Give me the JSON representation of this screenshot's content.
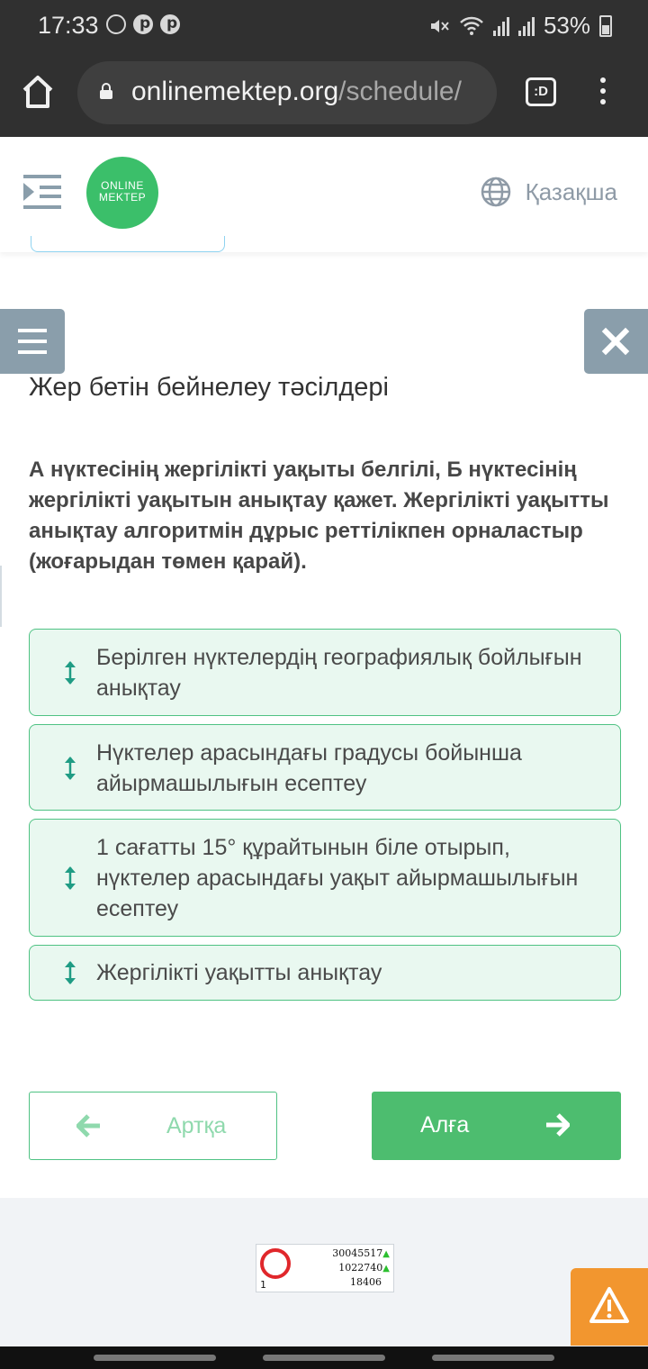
{
  "status_bar": {
    "time": "17:33",
    "battery": "53%"
  },
  "browser": {
    "url_domain": "onlinemektep.org",
    "url_path": "/schedule/",
    "tab_switcher_label": ":D"
  },
  "header": {
    "logo_line1": "ONLINE",
    "logo_line2": "MEKTEP",
    "language": "Қазақша"
  },
  "lesson": {
    "topic_title": "Жер бетін бейнелеу тәсілдері",
    "question": "А нүктесінің жергілікті уақыты белгілі, Б нүктесінің жергілікті уақытын анықтау қажет. Жергілікті уақытты анықтау алгоритмін дұрыс реттілікпен орналастыр (жоғарыдан төмен қарай).",
    "answers": [
      "Берілген нүктелердің географиялық бойлығын анықтау",
      "Нүктелер арасындағы градусы бойынша айырмашылығын есептеу",
      "1 сағатты 15° құрайтынын біле отырып, нүктелер арасындағы уақыт айырмашылығын есептеу",
      "Жергілікті уақытты анықтау"
    ]
  },
  "nav": {
    "back_label": "Артқа",
    "next_label": "Алға"
  },
  "counter_widget": {
    "line1": "30045517",
    "line2": "1022740",
    "line3": "18406",
    "index": "1"
  },
  "colors": {
    "accent_green": "#4dbd6f",
    "answer_bg": "#e9f8f0",
    "side_button": "#8a9eab",
    "warning_orange": "#f2962f"
  }
}
